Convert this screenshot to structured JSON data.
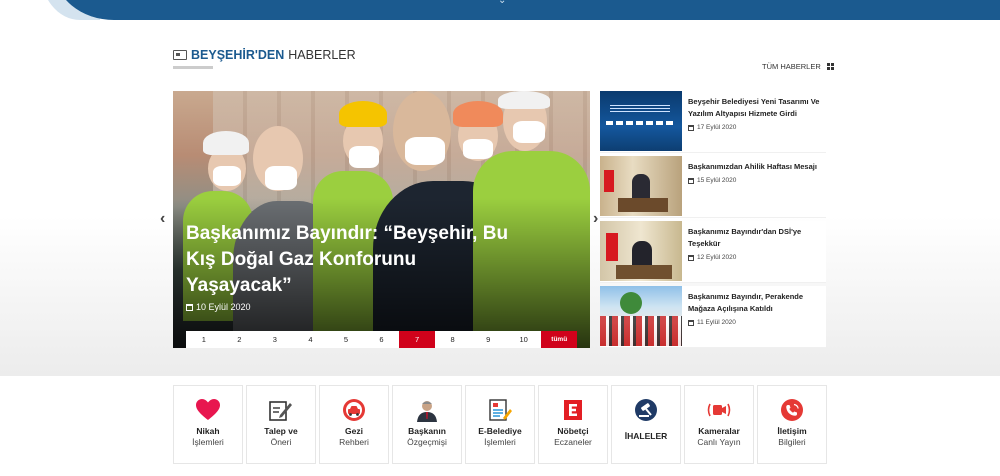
{
  "section": {
    "title_brand": "BEYŞEHİR'DEN",
    "title_rest": "HABERLER",
    "all_news_label": "TÜM HABERLER"
  },
  "slider": {
    "title": "Başkanımız Bayındır: “Beyşehir, Bu Kış Doğal Gaz Konforunu Yaşayacak”",
    "date": "10 Eylül 2020",
    "pages": [
      "1",
      "2",
      "3",
      "4",
      "5",
      "6",
      "7",
      "8",
      "9",
      "10"
    ],
    "active_page": "7",
    "all_label": "tümü"
  },
  "side_news": [
    {
      "title": "Beyşehir Belediyesi Yeni Tasarımı Ve Yazılım Altyapısı Hizmete Girdi",
      "date": "17 Eylül 2020"
    },
    {
      "title": "Başkanımızdan Ahilik Haftası Mesajı",
      "date": "15 Eylül 2020"
    },
    {
      "title": "Başkanımız Bayındır'dan DSİ'ye Teşekkür",
      "date": "12 Eylül 2020"
    },
    {
      "title": "Başkanımız Bayındır, Perakende Mağaza Açılışına Katıldı",
      "date": "11 Eylül 2020"
    }
  ],
  "quick_links": [
    {
      "line1": "Nikah",
      "line2": "İşlemleri",
      "icon": "heart-icon"
    },
    {
      "line1": "Talep ve",
      "line2": "Öneri",
      "icon": "edit-icon"
    },
    {
      "line1": "Gezi",
      "line2": "Rehberi",
      "icon": "car-icon"
    },
    {
      "line1": "Başkanın",
      "line2": "Özgeçmişi",
      "icon": "mayor-portrait-icon"
    },
    {
      "line1": "E-Belediye",
      "line2": "İşlemleri",
      "icon": "e-document-icon"
    },
    {
      "line1": "Nöbetçi",
      "line2": "Eczaneler",
      "icon": "pharmacy-icon"
    },
    {
      "line1": "İHALELER",
      "line2": "",
      "icon": "gavel-icon"
    },
    {
      "line1": "Kameralar",
      "line2": "Canlı Yayın",
      "icon": "camera-icon"
    },
    {
      "line1": "İletişim",
      "line2": "Bilgileri",
      "icon": "phone-icon"
    }
  ],
  "colors": {
    "brand_blue": "#1b5a8f",
    "accent_red": "#d0021b"
  }
}
